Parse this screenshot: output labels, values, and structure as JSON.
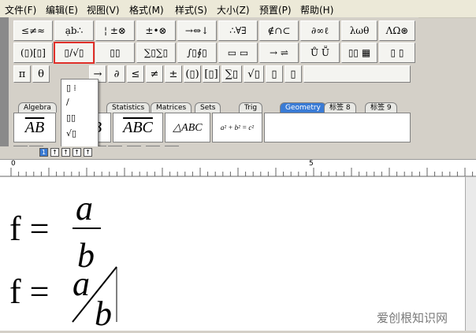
{
  "menu": [
    "文件(F)",
    "编辑(E)",
    "视图(V)",
    "格式(M)",
    "样式(S)",
    "大小(Z)",
    "预置(P)",
    "帮助(H)"
  ],
  "palette_row1": [
    "≤≠≈",
    "ạb∴",
    "¦ ±⊗",
    "±•⊗",
    "→⇔↓",
    "∴∀∃",
    "∉∩⊂",
    "∂∞ℓ",
    "λωθ",
    "ΛΩ⊛"
  ],
  "palette_row2": [
    "(▯)[▯]",
    "▯/√▯",
    "▯▯",
    "∑▯∑▯",
    "∫▯∮▯",
    "▭ ▭",
    "→ ⇌",
    "Ů Ṻ",
    "▯▯ ▦",
    "▯ ▯"
  ],
  "palette_row3": [
    "π",
    "θ",
    "",
    "→",
    "∂",
    "≤",
    "≠",
    "±",
    "(▯)",
    "[▯]",
    "∑▯",
    "√▯",
    "▯",
    "▯"
  ],
  "tabs": [
    "Algebra",
    "Statistics",
    "Matrices",
    "Sets",
    "Trig",
    "Geometry",
    "标签 8",
    "标签 9"
  ],
  "active_tab": "Geometry",
  "templates": [
    "AB",
    "B",
    "ABC",
    "△ABC",
    "a² + b² = c²"
  ],
  "geometry_symbols": [
    "∠",
    "⊿",
    "",
    "△",
    "▲",
    "□",
    "▱",
    "○"
  ],
  "dropdown_items": [
    "▯ ⁞",
    "∕",
    "▯▯",
    "√▯",
    "▯̲",
    "▯⃛"
  ],
  "size_buttons": [
    "1",
    "↑",
    "↑",
    "↑",
    "↑"
  ],
  "ruler": {
    "marks": [
      "0",
      "5"
    ]
  },
  "equations": [
    {
      "lhs": "f =",
      "numerator": "a",
      "denominator": "b"
    },
    {
      "lhs": "f =",
      "numerator": "a",
      "denominator": "b"
    }
  ],
  "watermark": "爱创根知识网",
  "colors": {
    "highlight": "#e0302a",
    "accent": "#3a7bd5"
  }
}
